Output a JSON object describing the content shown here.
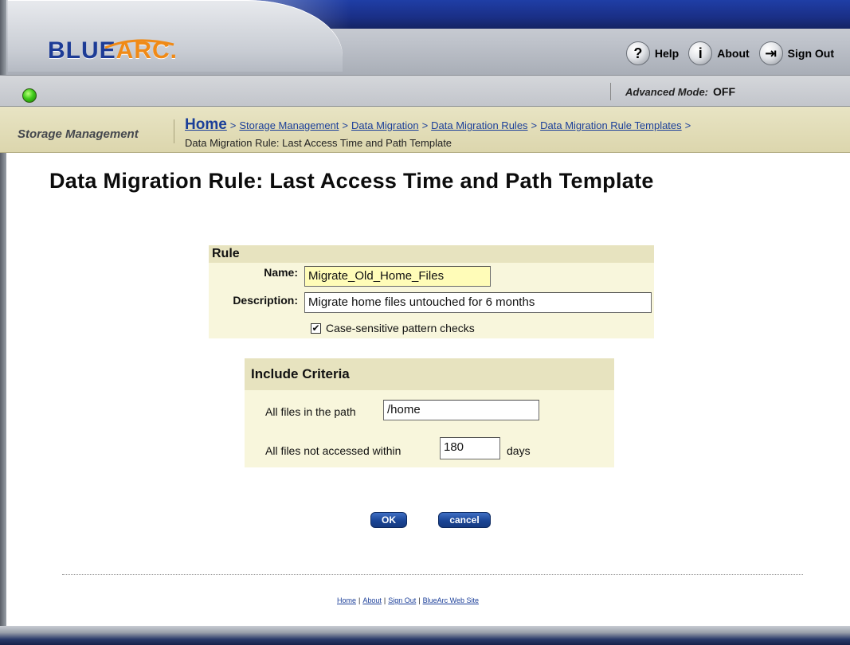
{
  "header": {
    "logo_text_blue": "BLUE",
    "logo_text_orange": "ARC.",
    "help_label": "Help",
    "about_label": "About",
    "signout_label": "Sign Out",
    "help_glyph": "?",
    "about_glyph": "i",
    "signout_glyph": "⇥",
    "colors": {
      "brand_blue": "#1d3c96",
      "brand_orange": "#f08a16",
      "status_green": "#3fcb1a"
    }
  },
  "status": {
    "advanced_mode_label": "Advanced Mode:",
    "advanced_mode_value": "OFF"
  },
  "breadcrumb": {
    "section": "Storage Management",
    "items": [
      "Home",
      "Storage Management",
      "Data Migration",
      "Data Migration Rules",
      "Data Migration Rule Templates"
    ],
    "separator": ">",
    "current": "Data Migration Rule: Last Access Time and Path Template"
  },
  "page": {
    "title": "Data Migration Rule: Last Access Time and Path Template"
  },
  "rule": {
    "heading": "Rule",
    "name_label": "Name:",
    "name_value": "Migrate_Old_Home_Files",
    "description_label": "Description:",
    "description_value": "Migrate home files untouched for 6 months",
    "case_sensitive_label": "Case-sensitive pattern checks",
    "case_sensitive_checked": "✔"
  },
  "criteria": {
    "heading": "Include Criteria",
    "path_label": "All files in the path",
    "path_value": "/home",
    "access_label": "All files not accessed within",
    "access_value": "180",
    "access_unit": "days"
  },
  "buttons": {
    "ok_label": "OK",
    "cancel_label": "cancel"
  },
  "footer": {
    "links": [
      "Home",
      "About",
      "Sign Out",
      "BlueArc Web Site"
    ],
    "pipe": "|"
  }
}
